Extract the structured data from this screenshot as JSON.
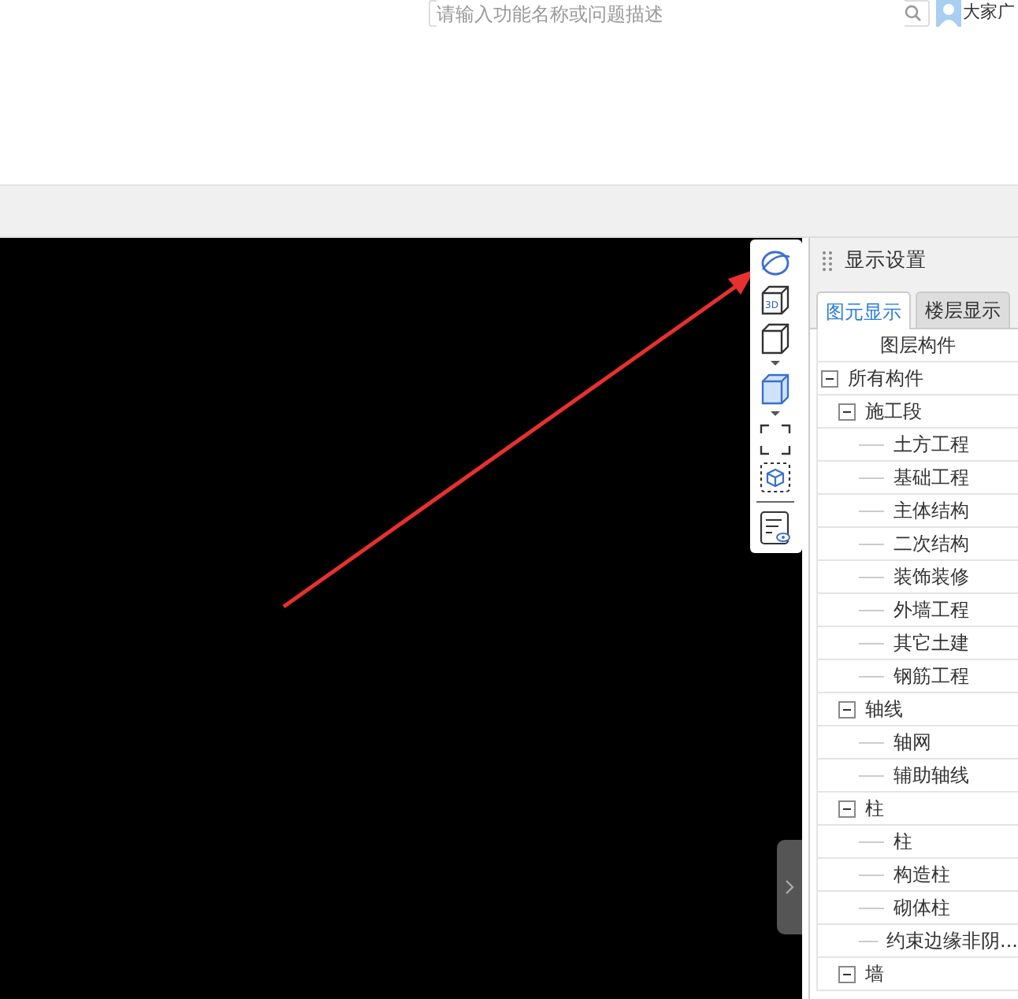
{
  "search": {
    "placeholder": "请输入功能名称或问题描述"
  },
  "user": {
    "name": "大家广"
  },
  "panel": {
    "title": "显示设置",
    "tabs": [
      {
        "label": "图元显示",
        "selected": true
      },
      {
        "label": "楼层显示",
        "selected": false
      }
    ],
    "tree_header": "图层构件",
    "tree": [
      {
        "label": "所有构件",
        "expanded": true,
        "children": [
          {
            "label": "施工段",
            "expanded": true,
            "children": [
              {
                "label": "土方工程"
              },
              {
                "label": "基础工程"
              },
              {
                "label": "主体结构"
              },
              {
                "label": "二次结构"
              },
              {
                "label": "装饰装修"
              },
              {
                "label": "外墙工程"
              },
              {
                "label": "其它土建"
              },
              {
                "label": "钢筋工程"
              }
            ]
          },
          {
            "label": "轴线",
            "expanded": true,
            "children": [
              {
                "label": "轴网"
              },
              {
                "label": "辅助轴线"
              }
            ]
          },
          {
            "label": "柱",
            "expanded": true,
            "children": [
              {
                "label": "柱"
              },
              {
                "label": "构造柱"
              },
              {
                "label": "砌体柱"
              },
              {
                "label": "约束边缘非阴..."
              }
            ]
          },
          {
            "label": "墙",
            "expanded": true
          }
        ]
      }
    ]
  },
  "toolbar": {
    "box_label": "3D"
  }
}
